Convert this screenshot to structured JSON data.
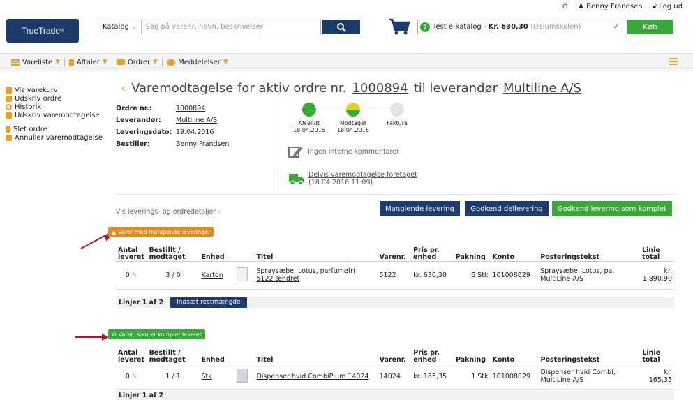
{
  "header": {
    "logo_text": "TrueTrade",
    "logo_mark": "®",
    "search_category": "Katalog",
    "search_placeholder": "Søg på varenr, navn, beskrivelser",
    "catalog_count": "1",
    "catalog_name": "Test e-katalog - ",
    "catalog_amount": "Kr. 630,30",
    "catalog_school": "(Dalumskolen)",
    "buy_label": "Køb",
    "user_name": "Benny Frandsen",
    "logout_label": "Log ud"
  },
  "nav": {
    "items": [
      {
        "label": "Vareliste"
      },
      {
        "label": "Aftaler"
      },
      {
        "label": "Ordrer"
      },
      {
        "label": "Meddelelser"
      }
    ]
  },
  "sidebar": {
    "items": [
      {
        "label": "Vis varekurv"
      },
      {
        "label": "Udskriv ordre"
      },
      {
        "label": "Historik"
      },
      {
        "label": "Udskriv varemodtagelse"
      },
      {
        "label": "Slet ordre"
      },
      {
        "label": "Annuller varemodtagelse"
      }
    ]
  },
  "page": {
    "title_prefix": "Varemodtagelse for aktiv ordre nr.",
    "order_no": "1000894",
    "title_mid": "til leverandør",
    "supplier": "Multiline A/S"
  },
  "info": {
    "order_label": "Ordre nr.:",
    "order_value": "1000894",
    "supplier_label": "Leverandør:",
    "supplier_value": "Multiline A/S",
    "date_label": "Leveringsdato:",
    "date_value": "19.04.2016",
    "buyer_label": "Bestiller:",
    "buyer_value": "Benny Frandsen"
  },
  "status": {
    "steps": [
      {
        "label": "Afsendt",
        "date": "18.04.2016"
      },
      {
        "label": "Modtaget",
        "date": "18.04.2016"
      },
      {
        "label": "Faktura",
        "date": ""
      }
    ],
    "comment": "Ingen interne kommentarer",
    "delivery_link": "Delvis varemodtagelse foretaget",
    "delivery_time": "(18.04.2016 11:09)"
  },
  "actions": {
    "details_link": "Vis leverings- og ordredetaljer",
    "missing": "Manglende levering",
    "partial": "Godkend dellevering",
    "complete": "Godkend levering som komplet"
  },
  "columns": {
    "qty_a": "Antal",
    "qty_b": "leveret",
    "ord_a": "Bestillt /",
    "ord_b": "modtaget",
    "unit": "Enhed",
    "title": "Titel",
    "itemno": "Varenr.",
    "price_a": "Pris pr.",
    "price_b": "enhed",
    "pack": "Pakning",
    "account": "Konto",
    "posting": "Posteringstekst",
    "total_a": "Linie",
    "total_b": "total"
  },
  "missing_section": {
    "badge": "Varer med manglende leveringer",
    "row": {
      "qty": "0",
      "ordered": "3 / 0",
      "unit": "Karton",
      "title_a": "Spraysæbe, Lotus, parfumefri",
      "title_b": "5122 ændret",
      "itemno": "5122",
      "price": "kr. 630,30",
      "pack": "6 Stk",
      "account": "101008029",
      "posting_a": "Spraysæbe, Lotus, pa,",
      "posting_b": "MultiLine A/S",
      "total_a": "kr.",
      "total_b": "1.890,90"
    },
    "lines": "Linjer 1 af 2",
    "insert_btn": "Indsæt restmængde"
  },
  "complete_section": {
    "badge": "Varer, som er komplet leveret",
    "row": {
      "qty": "0",
      "ordered": "1 / 1",
      "unit": "Stk",
      "title_a": "Dispenser hvid CombiPlum 14024",
      "itemno": "14024",
      "price": "kr. 165,35",
      "pack": "1 Stk",
      "account": "101008029",
      "posting_a": "Dispenser hvid Combi,",
      "posting_b": "MultiLine A/S",
      "total_a": "kr.",
      "total_b": "165,35"
    },
    "lines": "Linjer 1 af 2"
  },
  "colors": {
    "accent": "#f0a020",
    "navy": "#1f3b6e",
    "green": "#3aa83a",
    "arrow": "#c0102a"
  }
}
